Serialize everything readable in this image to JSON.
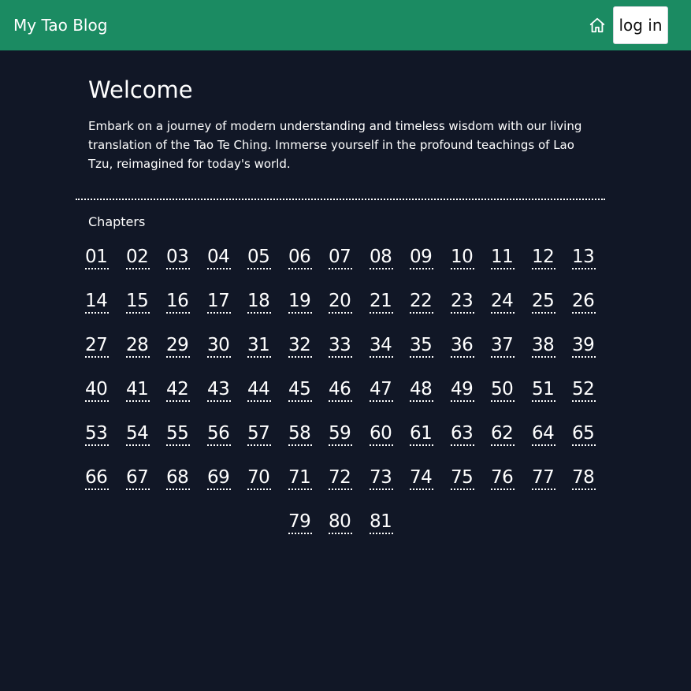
{
  "header": {
    "brand": "My Tao Blog",
    "home_icon": "home-icon",
    "login_label": "log in",
    "background": "#1b8b62"
  },
  "main": {
    "title": "Welcome",
    "intro": "Embark on a journey of modern understanding and timeless wisdom with our living translation of the Tao Te Ching. Immerse yourself in the profound teachings of Lao Tzu, reimagined for today's world.",
    "chapters_heading": "Chapters",
    "chapters": [
      "01",
      "02",
      "03",
      "04",
      "05",
      "06",
      "07",
      "08",
      "09",
      "10",
      "11",
      "12",
      "13",
      "14",
      "15",
      "16",
      "17",
      "18",
      "19",
      "20",
      "21",
      "22",
      "23",
      "24",
      "25",
      "26",
      "27",
      "28",
      "29",
      "30",
      "31",
      "32",
      "33",
      "34",
      "35",
      "36",
      "37",
      "38",
      "39",
      "40",
      "41",
      "42",
      "43",
      "44",
      "45",
      "46",
      "47",
      "48",
      "49",
      "50",
      "51",
      "52",
      "53",
      "54",
      "55",
      "56",
      "57",
      "58",
      "59",
      "60",
      "61",
      "63",
      "62",
      "64",
      "65",
      "66",
      "67",
      "68",
      "69",
      "70",
      "71",
      "72",
      "73",
      "74",
      "75",
      "76",
      "77",
      "78",
      "79",
      "80",
      "81"
    ]
  }
}
